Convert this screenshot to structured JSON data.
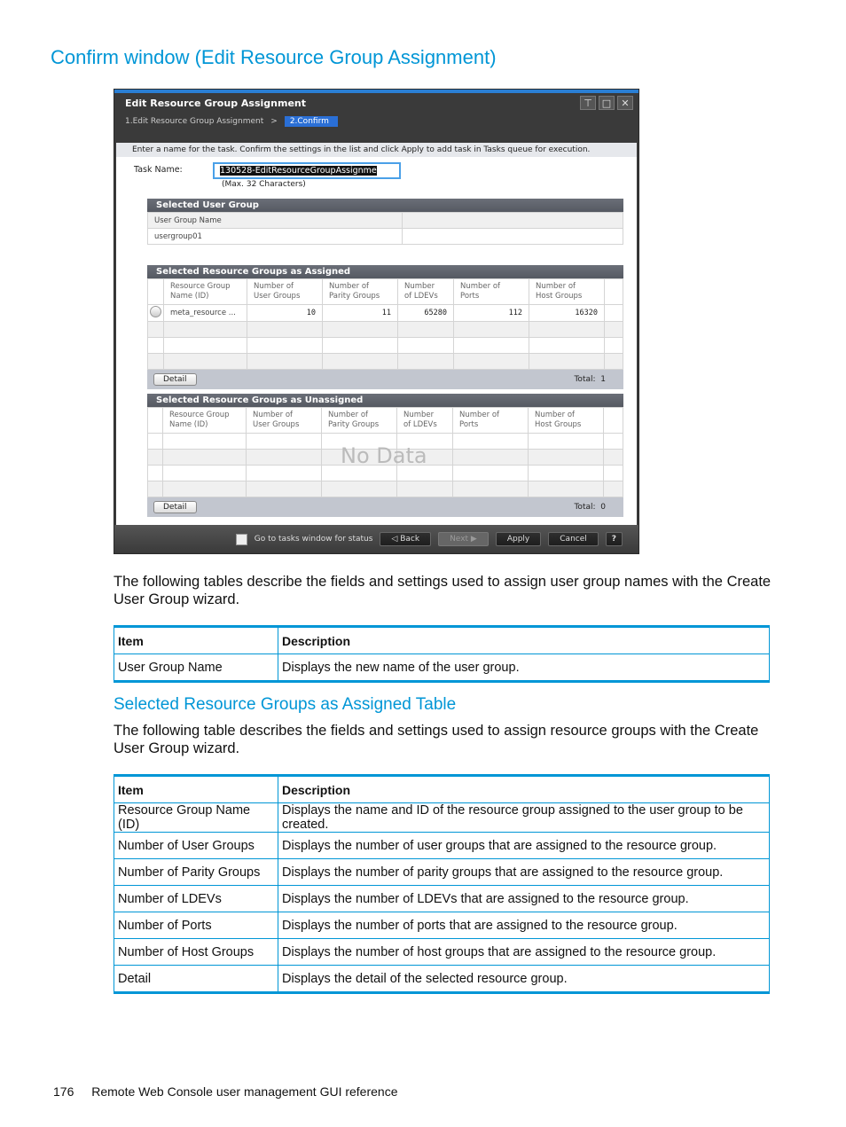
{
  "heading": "Confirm window (Edit Resource Group Assignment)",
  "window": {
    "title": "Edit Resource Group Assignment",
    "controls": [
      "pin-icon",
      "maximize-icon",
      "close-icon"
    ],
    "breadcrumb": {
      "step1": "1.Edit Resource Group Assignment",
      "separator": ">",
      "step2": "2.Confirm"
    },
    "instruction": "Enter a name for the task. Confirm the settings in the list and click Apply to add task in Tasks queue for execution.",
    "task_name": {
      "label": "Task Name:",
      "value": "130528-EditResourceGroupAssignme",
      "hint": "(Max. 32 Characters)"
    },
    "selected_user_group": {
      "title": "Selected User Group",
      "header": "User Group Name",
      "value": "usergroup01"
    },
    "assigned": {
      "title": "Selected Resource Groups as Assigned",
      "columns": [
        "Resource Group\nName (ID)",
        "Number of\nUser Groups",
        "Number of\nParity Groups",
        "Number\nof LDEVs",
        "Number of\nPorts",
        "Number of\nHost Groups"
      ],
      "rows": [
        {
          "name": "meta_resource ...",
          "user_groups": "10",
          "parity_groups": "11",
          "ldevs": "65280",
          "ports": "112",
          "host_groups": "16320"
        }
      ],
      "detail_label": "Detail",
      "total_label": "Total:",
      "total": "1"
    },
    "unassigned": {
      "title": "Selected Resource Groups as Unassigned",
      "columns": [
        "Resource Group\nName (ID)",
        "Number of\nUser Groups",
        "Number of\nParity Groups",
        "Number\nof LDEVs",
        "Number of\nPorts",
        "Number of\nHost Groups"
      ],
      "no_data": "No Data",
      "detail_label": "Detail",
      "total_label": "Total:",
      "total": "0"
    },
    "footer": {
      "checkbox_label": "Go to tasks window for status",
      "back": "Back",
      "next": "Next",
      "apply": "Apply",
      "cancel": "Cancel",
      "help": "?"
    }
  },
  "intro_paragraph": "The following tables describe the fields and settings used to assign user group names with the Create User Group wizard.",
  "table1": {
    "headers": [
      "Item",
      "Description"
    ],
    "rows": [
      [
        "User Group Name",
        "Displays the new name of the user group."
      ]
    ]
  },
  "section2_title": "Selected Resource Groups as Assigned Table",
  "section2_paragraph": "The following table describes the fields and settings used to assign resource groups with the Create User Group wizard.",
  "table2": {
    "headers": [
      "Item",
      "Description"
    ],
    "rows": [
      [
        "Resource Group Name (ID)",
        "Displays the name and ID of the resource group assigned to the user group to be created."
      ],
      [
        "Number of User Groups",
        "Displays the number of user groups that are assigned to the resource group."
      ],
      [
        "Number of Parity Groups",
        "Displays the number of parity groups that are assigned to the resource group."
      ],
      [
        "Number of LDEVs",
        "Displays the number of LDEVs that are assigned to the resource group."
      ],
      [
        "Number of Ports",
        "Displays the number of ports that are assigned to the resource group."
      ],
      [
        "Number of Host Groups",
        "Displays the number of host groups that are assigned to the resource group."
      ],
      [
        "Detail",
        "Displays the detail of the selected resource group."
      ]
    ]
  },
  "footer": {
    "page_number": "176",
    "text": "Remote Web Console user management GUI reference"
  }
}
